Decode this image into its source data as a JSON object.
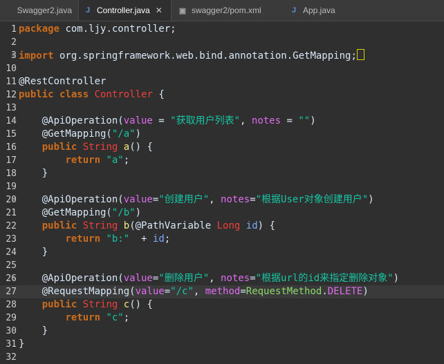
{
  "tabs": [
    {
      "label": "Swagger2.java",
      "icon": "java-file-icon"
    },
    {
      "label": "Controller.java",
      "icon": "java-file-icon",
      "active": true,
      "close": "✕"
    },
    {
      "label": "swagger2/pom.xml",
      "icon": "xml-file-icon"
    },
    {
      "label": "App.java",
      "icon": "java-file-icon"
    }
  ],
  "lines": [
    {
      "n": "1",
      "parts": [
        [
          "kw",
          "package"
        ],
        [
          "plain",
          " com.ljy.controller;"
        ]
      ]
    },
    {
      "n": "2",
      "parts": []
    },
    {
      "n": "3",
      "fold": "⊕",
      "parts": [
        [
          "kw",
          "import"
        ],
        [
          "plain",
          " org.springframework.web.bind.annotation.GetMapping;"
        ]
      ]
    },
    {
      "n": "10",
      "parts": []
    },
    {
      "n": "11",
      "parts": [
        [
          "ann",
          "@RestController"
        ]
      ]
    },
    {
      "n": "12",
      "parts": [
        [
          "kw",
          "public"
        ],
        [
          "plain",
          " "
        ],
        [
          "kw",
          "class"
        ],
        [
          "plain",
          " "
        ],
        [
          "cls",
          "Controller"
        ],
        [
          "plain",
          " {"
        ]
      ]
    },
    {
      "n": "13",
      "parts": []
    },
    {
      "n": "14",
      "fold": "⊖",
      "parts": [
        [
          "plain",
          "    @ApiOperation("
        ],
        [
          "pink",
          "value"
        ],
        [
          "plain",
          " = "
        ],
        [
          "str",
          "\"获取用户列表\""
        ],
        [
          "plain",
          ", "
        ],
        [
          "pink",
          "notes"
        ],
        [
          "plain",
          " = "
        ],
        [
          "str",
          "\"\""
        ],
        [
          "plain",
          ")"
        ]
      ]
    },
    {
      "n": "15",
      "parts": [
        [
          "plain",
          "    @GetMapping("
        ],
        [
          "str",
          "\"/a\""
        ],
        [
          "plain",
          ")"
        ]
      ]
    },
    {
      "n": "16",
      "parts": [
        [
          "plain",
          "    "
        ],
        [
          "kw",
          "public"
        ],
        [
          "plain",
          " "
        ],
        [
          "cls",
          "String"
        ],
        [
          "plain",
          " "
        ],
        [
          "attr",
          "a"
        ],
        [
          "plain",
          "() {"
        ]
      ]
    },
    {
      "n": "17",
      "parts": [
        [
          "plain",
          "        "
        ],
        [
          "kw",
          "return"
        ],
        [
          "plain",
          " "
        ],
        [
          "str",
          "\"a\""
        ],
        [
          "plain",
          ";"
        ]
      ]
    },
    {
      "n": "18",
      "parts": [
        [
          "plain",
          "    }"
        ]
      ]
    },
    {
      "n": "19",
      "parts": []
    },
    {
      "n": "20",
      "fold": "⊖",
      "parts": [
        [
          "plain",
          "    @ApiOperation("
        ],
        [
          "pink",
          "value"
        ],
        [
          "plain",
          "="
        ],
        [
          "str",
          "\"创建用户\""
        ],
        [
          "plain",
          ", "
        ],
        [
          "pink",
          "notes"
        ],
        [
          "plain",
          "="
        ],
        [
          "str",
          "\"根据User对象创建用户\""
        ],
        [
          "plain",
          ")"
        ]
      ]
    },
    {
      "n": "21",
      "parts": [
        [
          "plain",
          "    @GetMapping("
        ],
        [
          "str",
          "\"/b\""
        ],
        [
          "plain",
          ")"
        ]
      ]
    },
    {
      "n": "22",
      "parts": [
        [
          "plain",
          "    "
        ],
        [
          "kw",
          "public"
        ],
        [
          "plain",
          " "
        ],
        [
          "cls",
          "String"
        ],
        [
          "plain",
          " "
        ],
        [
          "attr",
          "b"
        ],
        [
          "plain",
          "(@PathVariable "
        ],
        [
          "cls",
          "Long"
        ],
        [
          "plain",
          " "
        ],
        [
          "param",
          "id"
        ],
        [
          "plain",
          ") {"
        ]
      ]
    },
    {
      "n": "23",
      "parts": [
        [
          "plain",
          "        "
        ],
        [
          "kw",
          "return"
        ],
        [
          "plain",
          " "
        ],
        [
          "str",
          "\"b:\""
        ],
        [
          "plain",
          "  + "
        ],
        [
          "param",
          "id"
        ],
        [
          "plain",
          ";"
        ]
      ]
    },
    {
      "n": "24",
      "parts": [
        [
          "plain",
          "    }"
        ]
      ]
    },
    {
      "n": "25",
      "parts": []
    },
    {
      "n": "26",
      "fold": "⊖",
      "parts": [
        [
          "plain",
          "    @ApiOperation("
        ],
        [
          "pink",
          "value"
        ],
        [
          "plain",
          "="
        ],
        [
          "str",
          "\"删除用户\""
        ],
        [
          "plain",
          ", "
        ],
        [
          "pink",
          "notes"
        ],
        [
          "plain",
          "="
        ],
        [
          "str",
          "\"根据url的id来指定删除对象\""
        ],
        [
          "plain",
          ")"
        ]
      ]
    },
    {
      "n": "27",
      "current": true,
      "parts": [
        [
          "plain",
          "    @RequestMapping("
        ],
        [
          "pink",
          "value"
        ],
        [
          "plain",
          "="
        ],
        [
          "str",
          "\"/c\""
        ],
        [
          "plain",
          ", "
        ],
        [
          "pink",
          "method"
        ],
        [
          "plain",
          "="
        ],
        [
          "const",
          "RequestMethod"
        ],
        [
          "plain",
          "."
        ],
        [
          "pink",
          "DELETE"
        ],
        [
          "plain",
          ")"
        ]
      ]
    },
    {
      "n": "28",
      "parts": [
        [
          "plain",
          "    "
        ],
        [
          "kw",
          "public"
        ],
        [
          "plain",
          " "
        ],
        [
          "cls",
          "String"
        ],
        [
          "plain",
          " "
        ],
        [
          "attr",
          "c"
        ],
        [
          "plain",
          "() {"
        ]
      ]
    },
    {
      "n": "29",
      "parts": [
        [
          "plain",
          "        "
        ],
        [
          "kw",
          "return"
        ],
        [
          "plain",
          " "
        ],
        [
          "str",
          "\"c\""
        ],
        [
          "plain",
          ";"
        ]
      ]
    },
    {
      "n": "30",
      "parts": [
        [
          "plain",
          "    }"
        ]
      ]
    },
    {
      "n": "31",
      "parts": [
        [
          "plain",
          "}"
        ]
      ]
    },
    {
      "n": "32",
      "parts": []
    }
  ]
}
